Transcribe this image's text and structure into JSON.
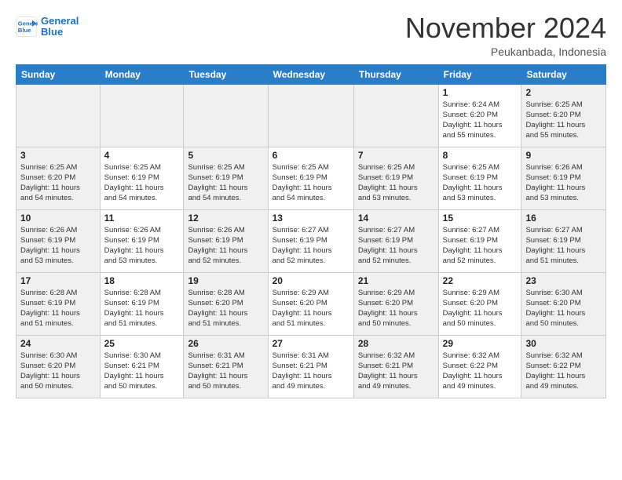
{
  "logo": {
    "line1": "General",
    "line2": "Blue"
  },
  "title": "November 2024",
  "location": "Peukanbada, Indonesia",
  "weekdays": [
    "Sunday",
    "Monday",
    "Tuesday",
    "Wednesday",
    "Thursday",
    "Friday",
    "Saturday"
  ],
  "weeks": [
    [
      {
        "day": "",
        "info": ""
      },
      {
        "day": "",
        "info": ""
      },
      {
        "day": "",
        "info": ""
      },
      {
        "day": "",
        "info": ""
      },
      {
        "day": "",
        "info": ""
      },
      {
        "day": "1",
        "info": "Sunrise: 6:24 AM\nSunset: 6:20 PM\nDaylight: 11 hours\nand 55 minutes."
      },
      {
        "day": "2",
        "info": "Sunrise: 6:25 AM\nSunset: 6:20 PM\nDaylight: 11 hours\nand 55 minutes."
      }
    ],
    [
      {
        "day": "3",
        "info": "Sunrise: 6:25 AM\nSunset: 6:20 PM\nDaylight: 11 hours\nand 54 minutes."
      },
      {
        "day": "4",
        "info": "Sunrise: 6:25 AM\nSunset: 6:19 PM\nDaylight: 11 hours\nand 54 minutes."
      },
      {
        "day": "5",
        "info": "Sunrise: 6:25 AM\nSunset: 6:19 PM\nDaylight: 11 hours\nand 54 minutes."
      },
      {
        "day": "6",
        "info": "Sunrise: 6:25 AM\nSunset: 6:19 PM\nDaylight: 11 hours\nand 54 minutes."
      },
      {
        "day": "7",
        "info": "Sunrise: 6:25 AM\nSunset: 6:19 PM\nDaylight: 11 hours\nand 53 minutes."
      },
      {
        "day": "8",
        "info": "Sunrise: 6:25 AM\nSunset: 6:19 PM\nDaylight: 11 hours\nand 53 minutes."
      },
      {
        "day": "9",
        "info": "Sunrise: 6:26 AM\nSunset: 6:19 PM\nDaylight: 11 hours\nand 53 minutes."
      }
    ],
    [
      {
        "day": "10",
        "info": "Sunrise: 6:26 AM\nSunset: 6:19 PM\nDaylight: 11 hours\nand 53 minutes."
      },
      {
        "day": "11",
        "info": "Sunrise: 6:26 AM\nSunset: 6:19 PM\nDaylight: 11 hours\nand 53 minutes."
      },
      {
        "day": "12",
        "info": "Sunrise: 6:26 AM\nSunset: 6:19 PM\nDaylight: 11 hours\nand 52 minutes."
      },
      {
        "day": "13",
        "info": "Sunrise: 6:27 AM\nSunset: 6:19 PM\nDaylight: 11 hours\nand 52 minutes."
      },
      {
        "day": "14",
        "info": "Sunrise: 6:27 AM\nSunset: 6:19 PM\nDaylight: 11 hours\nand 52 minutes."
      },
      {
        "day": "15",
        "info": "Sunrise: 6:27 AM\nSunset: 6:19 PM\nDaylight: 11 hours\nand 52 minutes."
      },
      {
        "day": "16",
        "info": "Sunrise: 6:27 AM\nSunset: 6:19 PM\nDaylight: 11 hours\nand 51 minutes."
      }
    ],
    [
      {
        "day": "17",
        "info": "Sunrise: 6:28 AM\nSunset: 6:19 PM\nDaylight: 11 hours\nand 51 minutes."
      },
      {
        "day": "18",
        "info": "Sunrise: 6:28 AM\nSunset: 6:19 PM\nDaylight: 11 hours\nand 51 minutes."
      },
      {
        "day": "19",
        "info": "Sunrise: 6:28 AM\nSunset: 6:20 PM\nDaylight: 11 hours\nand 51 minutes."
      },
      {
        "day": "20",
        "info": "Sunrise: 6:29 AM\nSunset: 6:20 PM\nDaylight: 11 hours\nand 51 minutes."
      },
      {
        "day": "21",
        "info": "Sunrise: 6:29 AM\nSunset: 6:20 PM\nDaylight: 11 hours\nand 50 minutes."
      },
      {
        "day": "22",
        "info": "Sunrise: 6:29 AM\nSunset: 6:20 PM\nDaylight: 11 hours\nand 50 minutes."
      },
      {
        "day": "23",
        "info": "Sunrise: 6:30 AM\nSunset: 6:20 PM\nDaylight: 11 hours\nand 50 minutes."
      }
    ],
    [
      {
        "day": "24",
        "info": "Sunrise: 6:30 AM\nSunset: 6:20 PM\nDaylight: 11 hours\nand 50 minutes."
      },
      {
        "day": "25",
        "info": "Sunrise: 6:30 AM\nSunset: 6:21 PM\nDaylight: 11 hours\nand 50 minutes."
      },
      {
        "day": "26",
        "info": "Sunrise: 6:31 AM\nSunset: 6:21 PM\nDaylight: 11 hours\nand 50 minutes."
      },
      {
        "day": "27",
        "info": "Sunrise: 6:31 AM\nSunset: 6:21 PM\nDaylight: 11 hours\nand 49 minutes."
      },
      {
        "day": "28",
        "info": "Sunrise: 6:32 AM\nSunset: 6:21 PM\nDaylight: 11 hours\nand 49 minutes."
      },
      {
        "day": "29",
        "info": "Sunrise: 6:32 AM\nSunset: 6:22 PM\nDaylight: 11 hours\nand 49 minutes."
      },
      {
        "day": "30",
        "info": "Sunrise: 6:32 AM\nSunset: 6:22 PM\nDaylight: 11 hours\nand 49 minutes."
      }
    ]
  ]
}
